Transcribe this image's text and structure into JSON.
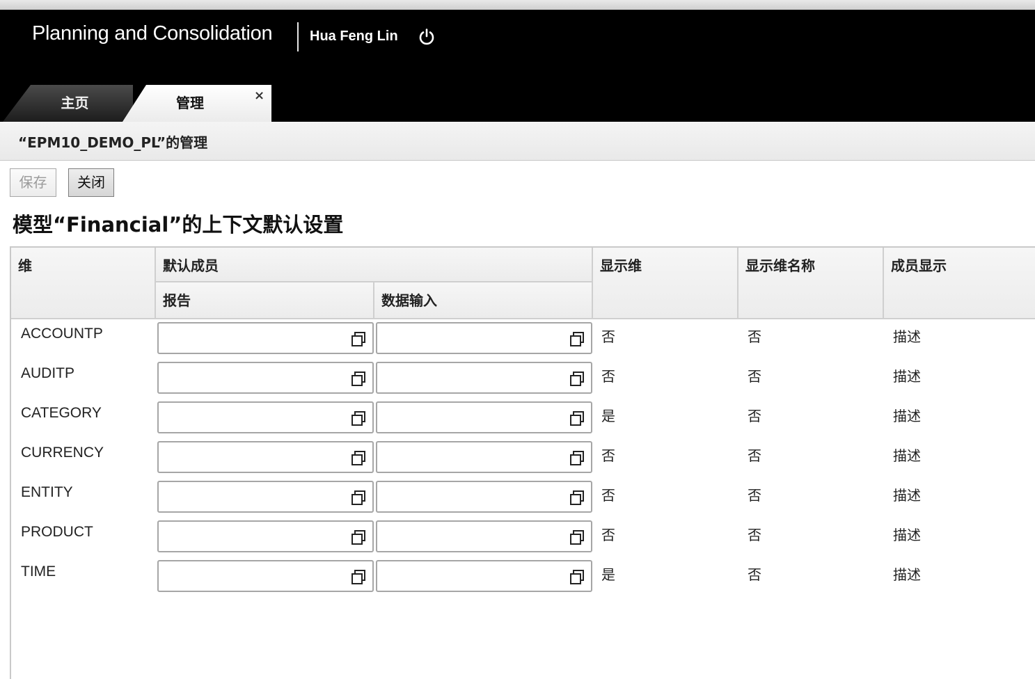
{
  "header": {
    "app_title": "Planning and Consolidation",
    "user_name": "Hua Feng Lin",
    "power_icon": "power-icon"
  },
  "tabs": [
    {
      "label": "主页",
      "active": false
    },
    {
      "label": "管理",
      "active": true,
      "close_icon": "×"
    }
  ],
  "breadcrumb": "“EPM10_DEMO_PL”的管理",
  "toolbar": {
    "save_label": "保存",
    "save_enabled": false,
    "close_label": "关闭"
  },
  "section_title": "模型“Financial”的上下文默认设置",
  "table": {
    "headers": {
      "dimension": "维",
      "default_member": "默认成员",
      "report": "报告",
      "data_input": "数据输入",
      "show_dimension": "显示维",
      "show_dimension_name": "显示维名称",
      "member_display": "成员显示"
    },
    "rows": [
      {
        "dimension": "ACCOUNTP",
        "report": "",
        "data_input": "",
        "show_dimension": "否",
        "show_dimension_name": "否",
        "member_display": "描述"
      },
      {
        "dimension": "AUDITP",
        "report": "",
        "data_input": "",
        "show_dimension": "否",
        "show_dimension_name": "否",
        "member_display": "描述"
      },
      {
        "dimension": "CATEGORY",
        "report": "",
        "data_input": "",
        "show_dimension": "是",
        "show_dimension_name": "否",
        "member_display": "描述"
      },
      {
        "dimension": "CURRENCY",
        "report": "",
        "data_input": "",
        "show_dimension": "否",
        "show_dimension_name": "否",
        "member_display": "描述"
      },
      {
        "dimension": "ENTITY",
        "report": "",
        "data_input": "",
        "show_dimension": "否",
        "show_dimension_name": "否",
        "member_display": "描述"
      },
      {
        "dimension": "PRODUCT",
        "report": "",
        "data_input": "",
        "show_dimension": "否",
        "show_dimension_name": "否",
        "member_display": "描述"
      },
      {
        "dimension": "TIME",
        "report": "",
        "data_input": "",
        "show_dimension": "是",
        "show_dimension_name": "否",
        "member_display": "描述"
      }
    ],
    "picker_icon": "member-selector-icon"
  }
}
